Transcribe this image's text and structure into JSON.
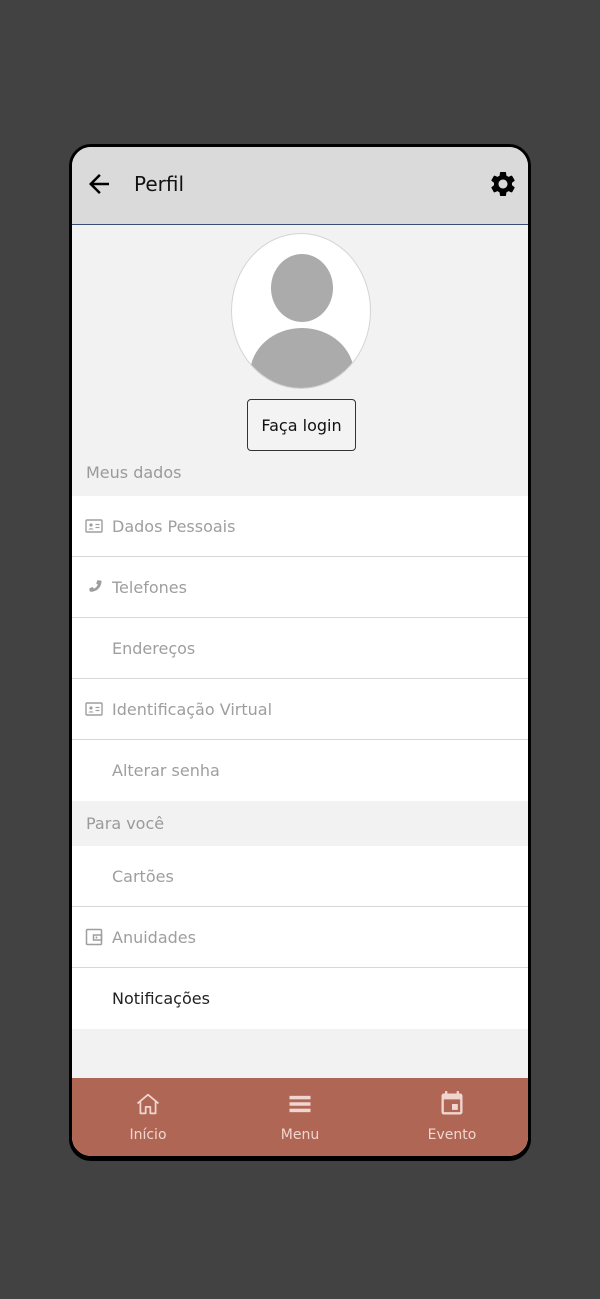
{
  "header": {
    "title": "Perfil",
    "back_icon": "arrow-left-icon",
    "settings_icon": "gear-icon"
  },
  "profile": {
    "login_label": "Faça login"
  },
  "sections": {
    "meus_dados": {
      "label": "Meus dados",
      "items": [
        {
          "label": "Dados Pessoais",
          "icon": "id-card-icon"
        },
        {
          "label": "Telefones",
          "icon": "phone-icon"
        },
        {
          "label": "Endereços",
          "icon": ""
        },
        {
          "label": "Identificação Virtual",
          "icon": "id-card-icon"
        },
        {
          "label": "Alterar senha",
          "icon": ""
        }
      ]
    },
    "para_voce": {
      "label": "Para você",
      "items": [
        {
          "label": "Cartões",
          "icon": ""
        },
        {
          "label": "Anuidades",
          "icon": "wallet-icon"
        },
        {
          "label": "Notificações",
          "icon": ""
        }
      ]
    }
  },
  "nav": {
    "items": [
      {
        "label": "Início",
        "icon": "home-icon"
      },
      {
        "label": "Menu",
        "icon": "menu-icon"
      },
      {
        "label": "Evento",
        "icon": "calendar-icon"
      }
    ]
  },
  "colors": {
    "header_bg": "#dadada",
    "nav_bg": "#af6655",
    "muted_text": "#9e9e9e"
  }
}
